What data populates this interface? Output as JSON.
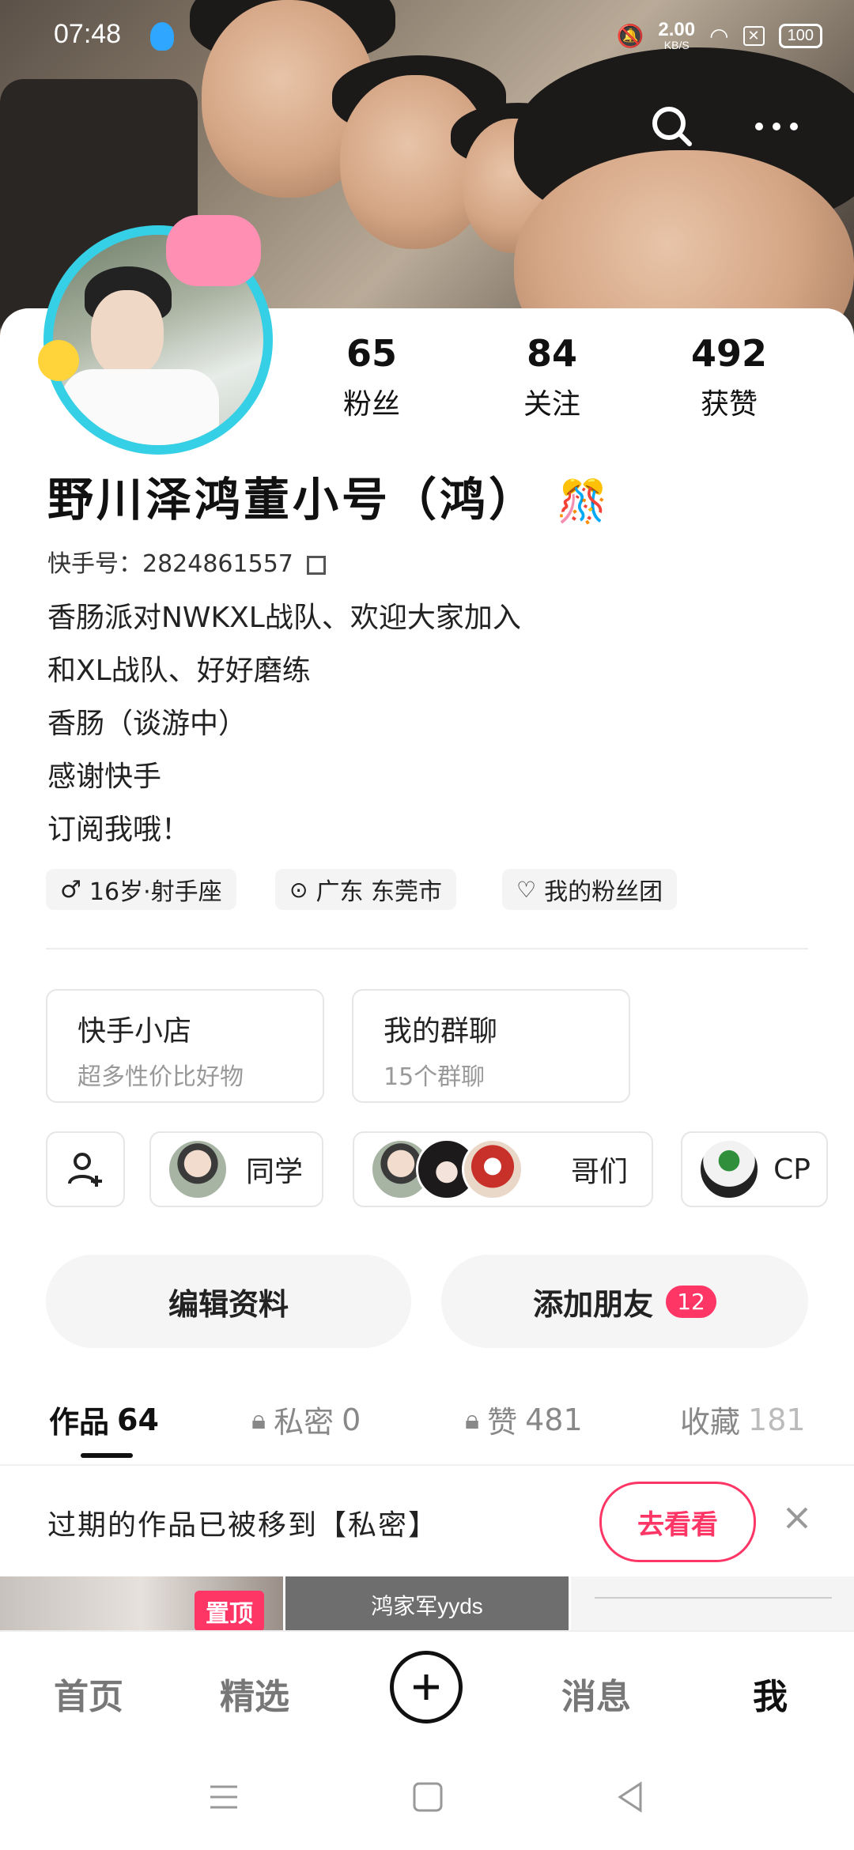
{
  "status": {
    "time": "07:48",
    "speed": "2.00",
    "speed_unit": "KB/S",
    "battery": "100"
  },
  "profile": {
    "stats": [
      {
        "value": "65",
        "label": "粉丝"
      },
      {
        "value": "84",
        "label": "关注"
      },
      {
        "value": "492",
        "label": "获赞"
      }
    ],
    "nickname": "野川泽鸿董小号（鸿）",
    "kuaishou_id": "快手号：2824861557",
    "bio": [
      "香肠派对NWKXL战队、欢迎大家加入",
      "和XL战队、好好磨练",
      "香肠（谈游中）",
      "感谢快手",
      "订阅我哦！"
    ],
    "tags": {
      "age": "16岁·射手座",
      "location": "广东 东莞市",
      "fan_group": "我的粉丝团"
    }
  },
  "features": {
    "shop": {
      "title": "快手小店",
      "sub": "超多性价比好物"
    },
    "group_chat": {
      "title": "我的群聊",
      "sub": "15个群聊"
    }
  },
  "friend_groups": {
    "classmates": "同学",
    "brothers": "哥们",
    "cp": "CP"
  },
  "actions": {
    "edit": "编辑资料",
    "add_friend": "添加朋友",
    "add_friend_badge": "12"
  },
  "tabs": {
    "works": {
      "label": "作品",
      "count": "64"
    },
    "private": {
      "label": "私密",
      "count": "0"
    },
    "likes": {
      "label": "赞",
      "count": "481"
    },
    "favorites": {
      "label": "收藏",
      "count": "181"
    }
  },
  "notice": {
    "text": "过期的作品已被移到【私密】",
    "button": "去看看"
  },
  "thumbs": {
    "pinned": "置顶",
    "caption": "鸿家军yyds"
  },
  "bottom_nav": {
    "home": "首页",
    "featured": "精选",
    "messages": "消息",
    "me": "我"
  }
}
